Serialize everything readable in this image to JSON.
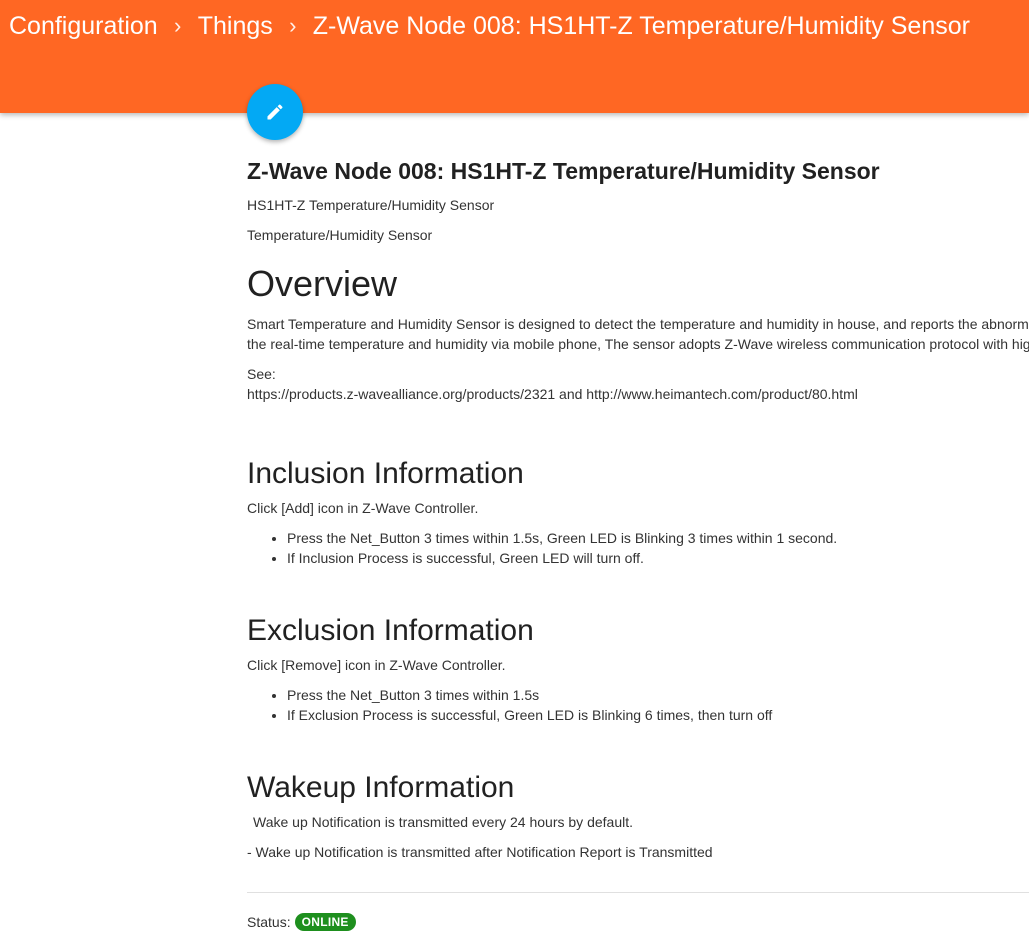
{
  "breadcrumb": {
    "items": [
      "Configuration",
      "Things",
      "Z-Wave Node 008: HS1HT-Z Temperature/Humidity Sensor"
    ],
    "separator": "›"
  },
  "fab": {
    "icon": "pencil-icon",
    "color": "#03a9f4"
  },
  "header": {
    "color": "#ff6723"
  },
  "thing": {
    "title": "Z-Wave Node 008: HS1HT-Z Temperature/Humidity Sensor",
    "label": "HS1HT-Z Temperature/Humidity Sensor",
    "category": "Temperature/Humidity Sensor"
  },
  "overview": {
    "heading": "Overview",
    "line1": "Smart Temperature and Humidity Sensor is designed to detect the temperature and humidity in house, and reports the abnormal",
    "line2": "the real-time temperature and humidity via mobile phone, The sensor adopts Z-Wave wireless communication protocol with high",
    "see_label": "See:",
    "see_links": "https://products.z-wavealliance.org/products/2321 and http://www.heimantech.com/product/80.html"
  },
  "inclusion": {
    "heading": "Inclusion Information",
    "intro": "Click [Add] icon in Z-Wave Controller.",
    "steps": [
      "Press the Net_Button 3 times within 1.5s, Green LED is Blinking 3 times within 1 second.",
      "If Inclusion Process is successful, Green LED will turn off."
    ]
  },
  "exclusion": {
    "heading": "Exclusion Information",
    "intro": "Click [Remove] icon in Z-Wave Controller.",
    "steps": [
      "Press the Net_Button 3 times within 1.5s",
      "If Exclusion Process is successful, Green LED is Blinking 6 times, then turn off"
    ]
  },
  "wakeup": {
    "heading": "Wakeup Information",
    "line1": "Wake up Notification is transmitted every 24 hours by default.",
    "line2": "-  Wake up Notification is transmitted after Notification Report is Transmitted"
  },
  "status": {
    "label": "Status:",
    "value": "ONLINE",
    "color": "#1e8f1e"
  }
}
